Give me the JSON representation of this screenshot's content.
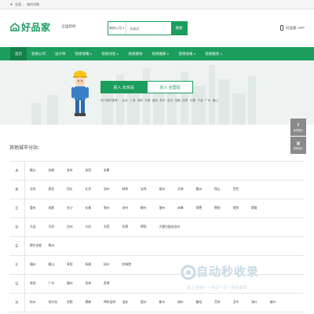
{
  "topbar": {
    "location": "全国",
    "switch": "城市切换"
  },
  "header": {
    "logo_text": "好品家",
    "slogan": "全国装修",
    "search": {
      "scope": "装修公司",
      "placeholder": "关键词",
      "button": "搜索"
    },
    "app_label": "好品家 APP"
  },
  "nav": {
    "items": [
      {
        "label": "首页",
        "dropdown": false
      },
      {
        "label": "装修公司",
        "dropdown": false
      },
      {
        "label": "设计师",
        "dropdown": false
      },
      {
        "label": "装修攻略",
        "dropdown": true
      },
      {
        "label": "装修问答",
        "dropdown": true
      },
      {
        "label": "装修建材",
        "dropdown": false
      },
      {
        "label": "装修图库",
        "dropdown": true
      },
      {
        "label": "装修效果",
        "dropdown": true
      },
      {
        "label": "装修服务",
        "dropdown": true
      }
    ]
  },
  "hero": {
    "enter_city": "进入 北京站",
    "enter_national": "进入 全国站",
    "hot_label": "热门城市推荐：",
    "hot_cities": [
      "北京",
      "上海",
      "深圳",
      "天津",
      "重庆",
      "杭州",
      "武汉",
      "成都",
      "西安",
      "长春",
      "宁波",
      "广州",
      "佛山"
    ]
  },
  "side": {
    "top_label": "免费报价",
    "bottom_label": "装修报价"
  },
  "other_title": "其他城市分站：",
  "rows": [
    {
      "letter": "A",
      "cities": [
        "鞍山",
        "安顺",
        "安庆",
        "安阳",
        "安康"
      ]
    },
    {
      "letter": "B",
      "cities": [
        "北京",
        "保定",
        "包头",
        "北京",
        "滨州",
        "蚌埠",
        "宝鸡",
        "亳州",
        "北海",
        "霸州",
        "保山",
        "百色"
      ]
    },
    {
      "letter": "C",
      "cities": [
        "重庆",
        "成都",
        "长沙",
        "长春",
        "常州",
        "沧州",
        "郴州",
        "潮州",
        "赤峰",
        "常德",
        "朝阳",
        "常熟",
        "楚雄"
      ]
    },
    {
      "letter": "D",
      "cities": [
        "大连",
        "大同",
        "达州",
        "大庆",
        "东莞",
        "东营",
        "德阳",
        "大理白族自治州"
      ]
    },
    {
      "letter": "E",
      "cities": [
        "鄂尔多斯",
        "鄂州"
      ]
    },
    {
      "letter": "F",
      "cities": [
        "福州",
        "佛山",
        "阜阳",
        "抚顺",
        "抚州",
        "防城港"
      ]
    },
    {
      "letter": "G",
      "cities": [
        "贵阳",
        "广州",
        "赣州",
        "桂林",
        "贵港"
      ]
    },
    {
      "letter": "H",
      "cities": [
        "杭州",
        "哈尔滨",
        "合肥",
        "邯郸",
        "呼和浩特",
        "淮安",
        "惠州",
        "衡水",
        "湖州",
        "衡阳",
        "菏泽",
        "汉中",
        "海口",
        "湖州"
      ]
    }
  ],
  "watermark": {
    "title": "自动秒收录",
    "subtitle": "做上 链接一一来访一次一自动收录"
  },
  "colors": {
    "brand": "#1b9d5d",
    "brand_dark": "#14804b",
    "hero_bg": "#eef3f1"
  }
}
